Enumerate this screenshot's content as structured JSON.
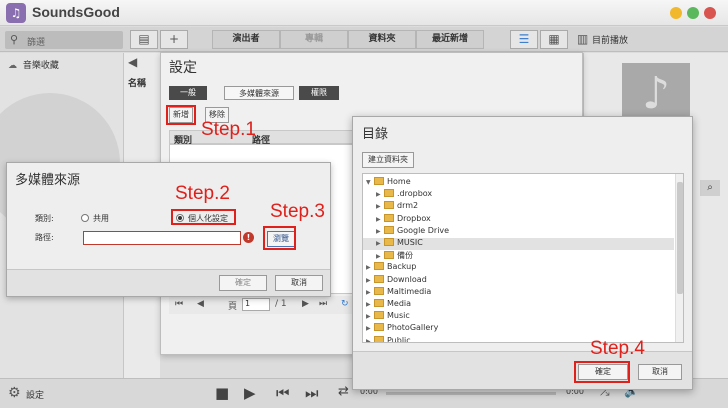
{
  "app": {
    "title": "SoundsGood",
    "logo_glyph": "♫"
  },
  "toolbar": {
    "search_placeholder": "篩選",
    "add_glyph": "+",
    "categories": [
      "演出者",
      "專輯",
      "資料夾",
      "最近新增"
    ],
    "now_playing": "目前播放"
  },
  "left_panel": {
    "item": "音樂收藏"
  },
  "content": {
    "col_name": "名稱"
  },
  "settings_dialog": {
    "title": "設定",
    "tabs": [
      "一般",
      "多媒體來源",
      "權限"
    ],
    "add_button": "新增",
    "remove_button": "移除",
    "columns": [
      "類別",
      "路徑"
    ],
    "pager": {
      "page_label": "頁",
      "page_value": "1",
      "page_total": "/ 1"
    }
  },
  "media_source_dialog": {
    "title": "多媒體來源",
    "type_label": "類別:",
    "option_shared": "共用",
    "option_personal": "個人化設定",
    "path_label": "路徑:",
    "warn_glyph": "!",
    "browse_button": "瀏覽",
    "ok_button": "確定",
    "cancel_button": "取消"
  },
  "directory_dialog": {
    "title": "目錄",
    "new_folder_button": "建立資料夾",
    "tree": [
      {
        "label": "Home",
        "expanded": true,
        "level": 0
      },
      {
        "label": ".dropbox",
        "level": 1
      },
      {
        "label": "drm2",
        "level": 1
      },
      {
        "label": "Dropbox",
        "level": 1
      },
      {
        "label": "Google Drive",
        "level": 1
      },
      {
        "label": "MUSIC",
        "level": 1,
        "selected": true
      },
      {
        "label": "備份",
        "level": 1
      },
      {
        "label": "Backup",
        "level": 0
      },
      {
        "label": "Download",
        "level": 0
      },
      {
        "label": "Maltimedia",
        "level": 0
      },
      {
        "label": "Media",
        "level": 0
      },
      {
        "label": "Music",
        "level": 0
      },
      {
        "label": "PhotoGallery",
        "level": 0
      },
      {
        "label": "Public",
        "level": 0
      }
    ],
    "ok_button": "確定",
    "cancel_button": "取消"
  },
  "bottom_bar": {
    "settings_label": "設定",
    "time_start": "0:00",
    "time_end": "0:00"
  },
  "annotations": {
    "step1": "Step.1",
    "step2": "Step.2",
    "step3": "Step.3",
    "step4": "Step.4",
    "highlight_color": "#e0201b"
  }
}
